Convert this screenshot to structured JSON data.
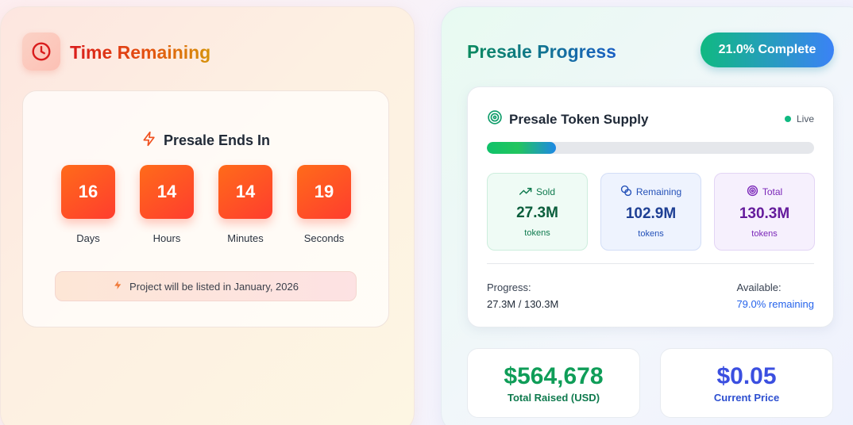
{
  "countdown": {
    "title": "Time Remaining",
    "ends_label": "Presale Ends In",
    "units": [
      {
        "value": "16",
        "label": "Days"
      },
      {
        "value": "14",
        "label": "Hours"
      },
      {
        "value": "14",
        "label": "Minutes"
      },
      {
        "value": "19",
        "label": "Seconds"
      }
    ],
    "listing_note": "Project will be listed in January, 2026"
  },
  "progress": {
    "title": "Presale Progress",
    "complete_badge": "21.0% Complete",
    "fill_percent": 21.0,
    "supply": {
      "title": "Presale Token Supply",
      "status": "Live",
      "stats": {
        "sold": {
          "label": "Sold",
          "value": "27.3M",
          "unit": "tokens"
        },
        "remaining": {
          "label": "Remaining",
          "value": "102.9M",
          "unit": "tokens"
        },
        "total": {
          "label": "Total",
          "value": "130.3M",
          "unit": "tokens"
        }
      },
      "progress_label": "Progress:",
      "progress_value": "27.3M / 130.3M",
      "available_label": "Available:",
      "available_value": "79.0% remaining"
    },
    "total_raised": {
      "value": "$564,678",
      "label": "Total Raised (USD)"
    },
    "current_price": {
      "value": "$0.05",
      "label": "Current Price"
    }
  },
  "colors": {
    "accent_orange": "#ff5a24",
    "accent_green": "#10b981",
    "accent_blue": "#3b82f6",
    "live_dot": "#10b981"
  },
  "icons": [
    "clock-icon",
    "lightning-icon",
    "target-icon",
    "trending-up-icon",
    "coins-icon"
  ]
}
